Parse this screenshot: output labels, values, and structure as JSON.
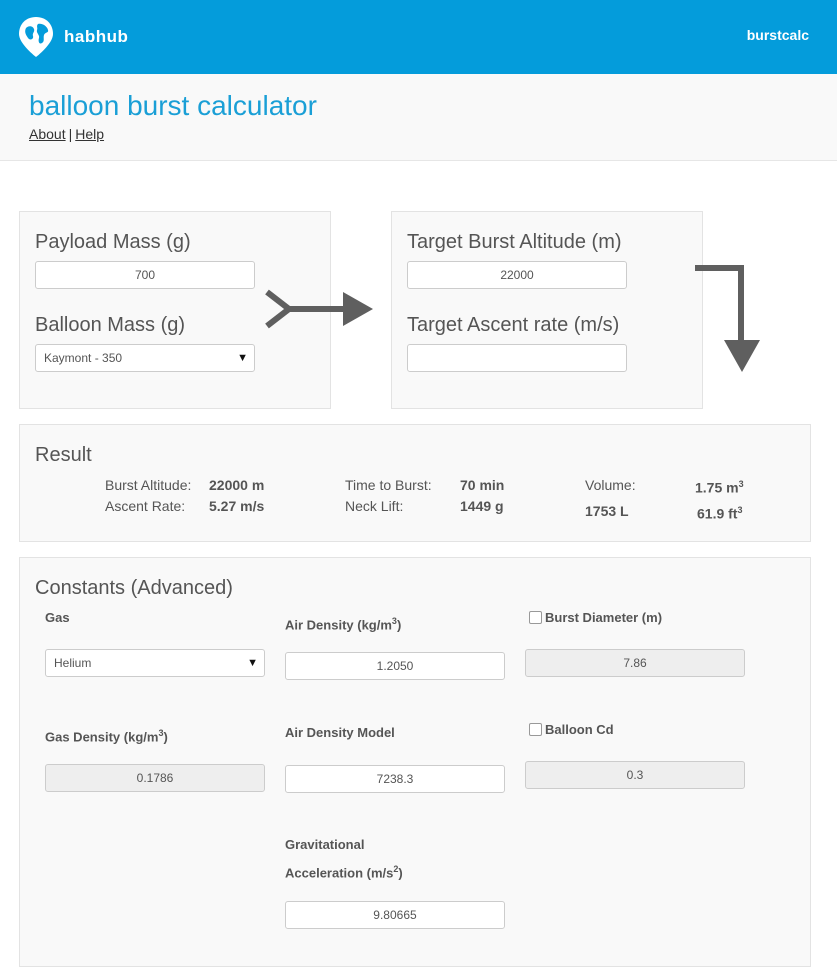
{
  "brand": {
    "name": "habhub",
    "logo_icon": "globe-pin-icon"
  },
  "nav": {
    "link": "burstcalc"
  },
  "header": {
    "title": "balloon burst calculator",
    "links": [
      "About",
      "Help"
    ],
    "separator": "|"
  },
  "inputs_left": {
    "payload_label": "Payload Mass (g)",
    "payload_value": "700",
    "balloon_label": "Balloon Mass (g)",
    "balloon_selected": "Kaymont - 350"
  },
  "inputs_right": {
    "altitude_label": "Target Burst Altitude (m)",
    "altitude_value": "22000",
    "ascent_label": "Target Ascent rate (m/s)",
    "ascent_value": ""
  },
  "result": {
    "title": "Result",
    "burst_altitude_label": "Burst Altitude:",
    "burst_altitude_value": "22000 m",
    "ascent_rate_label": "Ascent Rate:",
    "ascent_rate_value": "5.27 m/s",
    "time_to_burst_label": "Time to Burst:",
    "time_to_burst_value": "70 min",
    "neck_lift_label": "Neck Lift:",
    "neck_lift_value": "1449 g",
    "volume_label": "Volume:",
    "volume_m3": "1.75 m",
    "volume_litres": "1753 L",
    "volume_ft3": "61.9 ft",
    "cubed": "3"
  },
  "constants": {
    "title": "Constants (Advanced)",
    "gas_label": "Gas",
    "gas_selected": "Helium",
    "air_density_label": "Air Density (kg/m",
    "air_density_value": "1.2050",
    "burst_diameter_label": "Burst Diameter (m)",
    "burst_diameter_value": "7.86",
    "gas_density_label": "Gas Density (kg/m",
    "gas_density_value": "0.1786",
    "air_density_model_label": "Air Density Model",
    "air_density_model_value": "7238.3",
    "balloon_cd_label": "Balloon Cd",
    "balloon_cd_value": "0.3",
    "grav_label_1": "Gravitational",
    "grav_label_2": "Acceleration (m/s",
    "grav_value": "9.80665",
    "sup3": "3",
    "sup2": "2",
    "close_paren": ")"
  },
  "icons": {
    "caret": "▼"
  }
}
